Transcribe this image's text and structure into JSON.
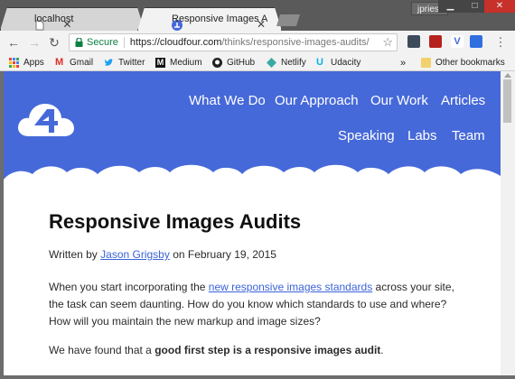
{
  "tabs": [
    {
      "title": "localhost",
      "active": false
    },
    {
      "title": "Responsive Images Audit",
      "active": true
    }
  ],
  "profile_name": "jpriest",
  "window_controls": [
    "minimize",
    "maximize",
    "close"
  ],
  "address_bar": {
    "secure_label": "Secure",
    "url_host": "https://cloudfour.com",
    "url_path": "/thinks/responsive-images-audits/"
  },
  "bookmarks": {
    "items": [
      "Apps",
      "Gmail",
      "Twitter",
      "Medium",
      "GitHub",
      "Netlify",
      "Udacity"
    ],
    "overflow": "»",
    "other": "Other bookmarks"
  },
  "site_nav": {
    "row1": [
      "What We Do",
      "Our Approach",
      "Our Work",
      "Articles"
    ],
    "row2": [
      "Speaking",
      "Labs",
      "Team"
    ]
  },
  "article": {
    "title": "Responsive Images Audits",
    "byline_prefix": "Written by",
    "author": "Jason Grigsby",
    "byline_suffix": "on February 19, 2015",
    "p1_before": "When you start incorporating the ",
    "p1_link": "new responsive images standards",
    "p1_after": " across your site, the task can seem daunting. How do you know which standards to use and where? How will you maintain the new markup and image sizes?",
    "p2_before": "We have found that a ",
    "p2_bold": "good first step is a responsive images audit",
    "p2_after": "."
  },
  "colors": {
    "brand_blue": "#4669d9",
    "link": "#3b63d8",
    "secure_green": "#0b8043"
  }
}
